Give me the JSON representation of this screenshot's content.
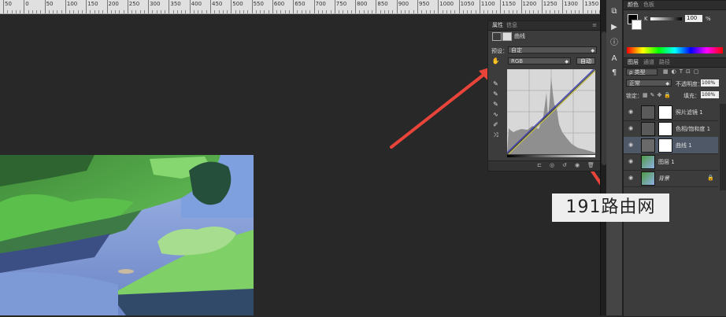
{
  "ruler": {
    "labels": [
      "50",
      "0",
      "50",
      "100",
      "150",
      "200",
      "250",
      "300",
      "350",
      "400",
      "450",
      "500",
      "550",
      "600",
      "650",
      "700",
      "750",
      "800",
      "850",
      "900",
      "950",
      "1000",
      "1050",
      "1100",
      "1150",
      "1200",
      "1250",
      "1300",
      "1350",
      "140"
    ]
  },
  "properties_panel": {
    "tabs": [
      "属性",
      "信息"
    ],
    "adjustment_title": "曲线",
    "preset_label": "预设：",
    "preset_value": "自定",
    "channel_value": "RGB",
    "auto_button": "自动"
  },
  "color_panel": {
    "tabs": [
      "颜色",
      "色板"
    ],
    "channel_label": "K",
    "k_value": "100",
    "percent": "%"
  },
  "layers_panel": {
    "tabs": [
      "图层",
      "通道",
      "路径"
    ],
    "kind_filter": "ρ 类型",
    "blend_mode": "正常",
    "opacity_label": "不透明度：",
    "opacity_value": "100%",
    "lock_label": "锁定：",
    "fill_label": "填充：",
    "fill_value": "100%",
    "layers": [
      {
        "name": "照片滤镜 1",
        "selected": false
      },
      {
        "name": "色相/饱和度 1",
        "selected": false
      },
      {
        "name": "曲线 1",
        "selected": true
      },
      {
        "name": "图层 1",
        "selected": false
      },
      {
        "name": "背景",
        "selected": false
      }
    ]
  },
  "watermark": {
    "text": "191路由网"
  },
  "colors": {
    "workspace": "#282828",
    "panel": "#3c3c3c",
    "arrow": "#e8443a",
    "selected_layer": "#4e5866"
  }
}
